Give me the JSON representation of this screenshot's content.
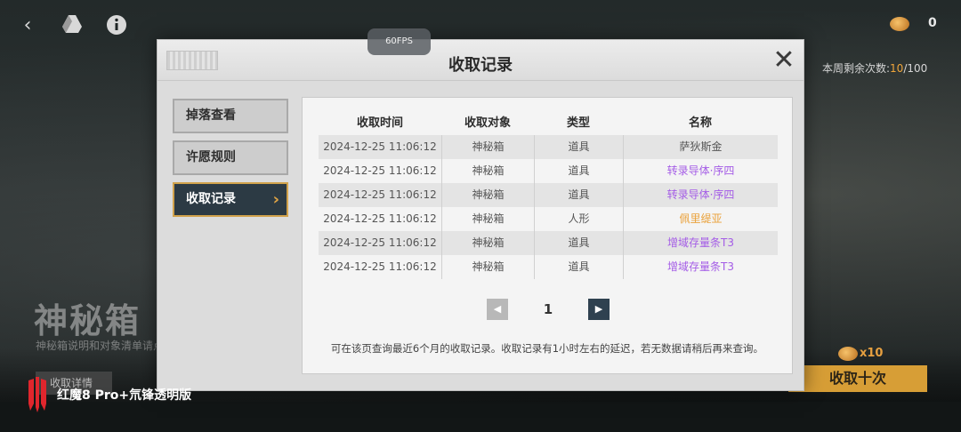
{
  "overlay": {
    "fps_label": "60FPS",
    "brand_text": "红魔8 Pro+氘锋透明版"
  },
  "background": {
    "currency_count": "0",
    "weekly_label": "本周剩余次数:",
    "weekly_used": "10",
    "weekly_total": "/100",
    "title": "神秘箱",
    "subtitle": "神秘箱说明和对象清单请点",
    "detail_button": "收取详情",
    "multiplier": "x10",
    "ten_pull_button": "收取十次"
  },
  "dialog": {
    "title": "收取记录",
    "sidebar": [
      {
        "label": "掉落查看",
        "active": false
      },
      {
        "label": "许愿规则",
        "active": false
      },
      {
        "label": "收取记录",
        "active": true
      }
    ],
    "table": {
      "headers": [
        "收取时间",
        "收取对象",
        "类型",
        "名称"
      ],
      "rows": [
        {
          "time": "2024-12-25 11:06:12",
          "target": "神秘箱",
          "type": "道具",
          "name": "萨狄斯金",
          "name_color": "#555555"
        },
        {
          "time": "2024-12-25 11:06:12",
          "target": "神秘箱",
          "type": "道具",
          "name": "转录导体·序四",
          "name_color": "#a45ce6"
        },
        {
          "time": "2024-12-25 11:06:12",
          "target": "神秘箱",
          "type": "道具",
          "name": "转录导体·序四",
          "name_color": "#a45ce6"
        },
        {
          "time": "2024-12-25 11:06:12",
          "target": "神秘箱",
          "type": "人形",
          "name": "佩里缇亚",
          "name_color": "#eaa23c"
        },
        {
          "time": "2024-12-25 11:06:12",
          "target": "神秘箱",
          "type": "道具",
          "name": "增域存量条T3",
          "name_color": "#a45ce6"
        },
        {
          "time": "2024-12-25 11:06:12",
          "target": "神秘箱",
          "type": "道具",
          "name": "增域存量条T3",
          "name_color": "#a45ce6"
        }
      ]
    },
    "pagination": {
      "current_page": "1"
    },
    "notice": "可在该页查询最近6个月的收取记录。收取记录有1小时左右的延迟，若无数据请稍后再来查询。"
  },
  "colors": {
    "accent_gold": "#d79e36",
    "active_tab_bg": "#2c3a44",
    "rarity_purple": "#a45ce6",
    "rarity_gold": "#eaa23c"
  }
}
